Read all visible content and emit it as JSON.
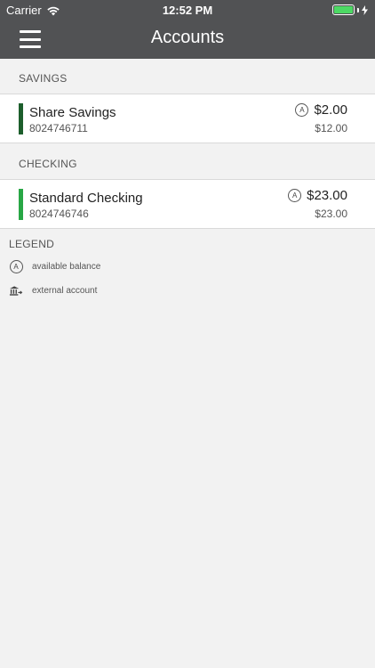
{
  "status_bar": {
    "carrier": "Carrier",
    "time": "12:52 PM"
  },
  "header": {
    "title": "Accounts"
  },
  "sections": [
    {
      "title": "SAVINGS",
      "accounts": [
        {
          "name": "Share Savings",
          "number": "8024746711",
          "available": "$2.00",
          "current": "$12.00",
          "color": "#1d5e2c"
        }
      ]
    },
    {
      "title": "CHECKING",
      "accounts": [
        {
          "name": "Standard Checking",
          "number": "8024746746",
          "available": "$23.00",
          "current": "$23.00",
          "color": "#28a745"
        }
      ]
    }
  ],
  "legend": {
    "title": "LEGEND",
    "items": [
      {
        "icon": "available-balance-icon",
        "glyph": "A",
        "label": "available balance"
      },
      {
        "icon": "external-account-icon",
        "label": "external account"
      }
    ]
  },
  "colors": {
    "header_bg": "#515254",
    "page_bg": "#f2f2f2",
    "battery": "#4cd964"
  }
}
